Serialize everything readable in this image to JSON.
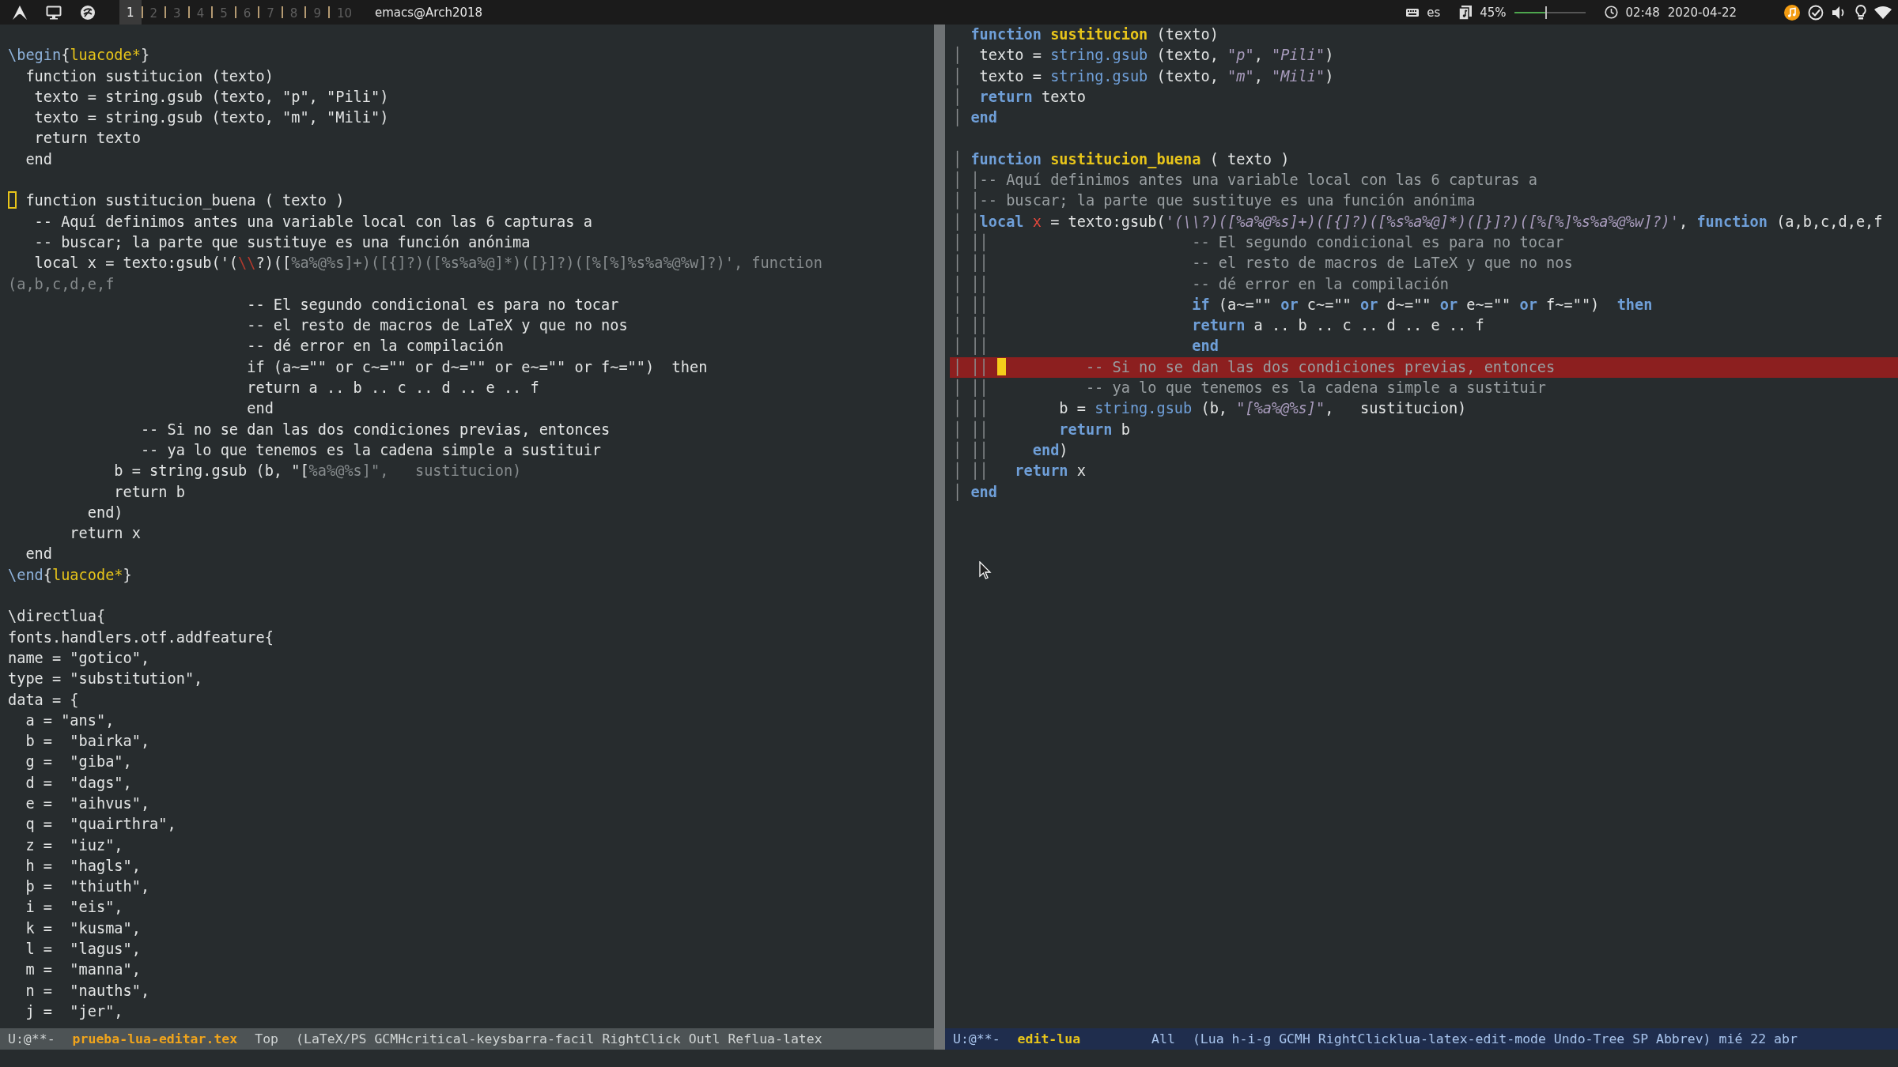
{
  "topbar": {
    "workspaces": [
      {
        "label": "1",
        "selected": true
      },
      {
        "label": "2",
        "selected": false
      },
      {
        "label": "3",
        "selected": false
      },
      {
        "label": "4",
        "selected": false
      },
      {
        "label": "5",
        "selected": false
      },
      {
        "label": "6",
        "selected": false
      },
      {
        "label": "7",
        "selected": false
      },
      {
        "label": "8",
        "selected": false
      },
      {
        "label": "9",
        "selected": false
      },
      {
        "label": "10",
        "selected": false
      }
    ],
    "window_title": "emacs@Arch2018",
    "keyboard_layout": "es",
    "volume": {
      "reading": "45%",
      "level": 0.45
    },
    "time": "02:48",
    "date": "2020-04-22"
  },
  "left_pane": {
    "active": false,
    "lines": [
      {
        "blank_before": true,
        "segments": [
          {
            "kind": "macro",
            "text": "\\begin"
          },
          {
            "kind": "plain",
            "text": "{"
          },
          {
            "kind": "env",
            "text": "luacode*"
          },
          {
            "kind": "plain",
            "text": "}"
          }
        ]
      },
      {
        "segments": [
          {
            "kind": "plain",
            "text": "  function sustitucion (texto)"
          }
        ]
      },
      {
        "segments": [
          {
            "kind": "plain",
            "text": "   texto = string.gsub (texto, \"p\", \"Pili\")"
          }
        ]
      },
      {
        "segments": [
          {
            "kind": "plain",
            "text": "   texto = string.gsub (texto, \"m\", \"Mili\")"
          }
        ]
      },
      {
        "segments": [
          {
            "kind": "plain",
            "text": "   return texto"
          }
        ]
      },
      {
        "segments": [
          {
            "kind": "plain",
            "text": "  end"
          }
        ]
      },
      {
        "blank_before": true,
        "segments": [
          {
            "kind": "plain",
            "text": " function sustitucion_buena ( texto )",
            "cursor_before": true
          }
        ]
      },
      {
        "segments": [
          {
            "kind": "plain",
            "text": "   -- Aquí definimos antes una variable local con las 6 capturas a"
          }
        ]
      },
      {
        "segments": [
          {
            "kind": "plain",
            "text": "   -- buscar; la parte que sustituye es una función anónima"
          }
        ]
      },
      {
        "segments": [
          {
            "kind": "plain",
            "text": "   local x = texto:gsub('("
          },
          {
            "kind": "escape",
            "text": "\\\\"
          },
          {
            "kind": "plain",
            "text": "?)(["
          },
          {
            "kind": "dim",
            "text": "%a%@%s]+)([{]?)([%s%a%@]*)([}]?)([%[%]%s%a%@%w]?)', function"
          }
        ]
      },
      {
        "segments": [
          {
            "kind": "dim",
            "text": "(a,b,c,d,e,f"
          }
        ]
      },
      {
        "segments": [
          {
            "kind": "plain",
            "text": "                           -- El segundo condicional es para no tocar"
          }
        ]
      },
      {
        "segments": [
          {
            "kind": "plain",
            "text": "                           -- el resto de macros de LaTeX y que no nos"
          }
        ]
      },
      {
        "segments": [
          {
            "kind": "plain",
            "text": "                           -- dé error en la compilación"
          }
        ]
      },
      {
        "segments": [
          {
            "kind": "plain",
            "text": "                           if (a~=\"\" or c~=\"\" or d~=\"\" or e~=\"\" or f~=\"\")  then"
          }
        ]
      },
      {
        "segments": [
          {
            "kind": "plain",
            "text": "                           return a .. b .. c .. d .. e .. f"
          }
        ]
      },
      {
        "segments": [
          {
            "kind": "plain",
            "text": "                           end"
          }
        ]
      },
      {
        "segments": [
          {
            "kind": "plain",
            "text": "               -- Si no se dan las dos condiciones previas, entonces"
          }
        ]
      },
      {
        "segments": [
          {
            "kind": "plain",
            "text": "               -- ya lo que tenemos es la cadena simple a sustituir"
          }
        ]
      },
      {
        "segments": [
          {
            "kind": "plain",
            "text": "            b = string.gsub (b, \"["
          },
          {
            "kind": "dim",
            "text": "%a%@%s]\",   sustitucion)"
          }
        ]
      },
      {
        "segments": [
          {
            "kind": "plain",
            "text": "            return b"
          }
        ]
      },
      {
        "segments": [
          {
            "kind": "plain",
            "text": "         end)"
          }
        ]
      },
      {
        "segments": [
          {
            "kind": "plain",
            "text": "       return x"
          }
        ]
      },
      {
        "segments": [
          {
            "kind": "plain",
            "text": "  end"
          }
        ]
      },
      {
        "segments": [
          {
            "kind": "macro",
            "text": "\\end"
          },
          {
            "kind": "plain",
            "text": "{"
          },
          {
            "kind": "env",
            "text": "luacode*"
          },
          {
            "kind": "plain",
            "text": "}"
          }
        ]
      },
      {
        "blank_before": true,
        "segments": [
          {
            "kind": "plain",
            "text": "\\directlua{"
          }
        ]
      },
      {
        "segments": [
          {
            "kind": "plain",
            "text": "fonts.handlers.otf.addfeature{"
          }
        ]
      },
      {
        "segments": [
          {
            "kind": "plain",
            "text": "name = \"gotico\","
          }
        ]
      },
      {
        "segments": [
          {
            "kind": "plain",
            "text": "type = \"substitution\","
          }
        ]
      },
      {
        "segments": [
          {
            "kind": "plain",
            "text": "data = {"
          }
        ]
      },
      {
        "segments": [
          {
            "kind": "plain",
            "text": "  a = \"ans\","
          }
        ]
      },
      {
        "segments": [
          {
            "kind": "plain",
            "text": "  b =  \"bairka\","
          }
        ]
      },
      {
        "segments": [
          {
            "kind": "plain",
            "text": "  g =  \"giba\","
          }
        ]
      },
      {
        "segments": [
          {
            "kind": "plain",
            "text": "  d =  \"dags\","
          }
        ]
      },
      {
        "segments": [
          {
            "kind": "plain",
            "text": "  e =  \"aihvus\","
          }
        ]
      },
      {
        "segments": [
          {
            "kind": "plain",
            "text": "  q =  \"quairthra\","
          }
        ]
      },
      {
        "segments": [
          {
            "kind": "plain",
            "text": "  z =  \"iuz\","
          }
        ]
      },
      {
        "segments": [
          {
            "kind": "plain",
            "text": "  h =  \"hagls\","
          }
        ]
      },
      {
        "segments": [
          {
            "kind": "plain",
            "text": "  þ =  \"thiuth\","
          }
        ]
      },
      {
        "segments": [
          {
            "kind": "plain",
            "text": "  i =  \"eis\","
          }
        ]
      },
      {
        "segments": [
          {
            "kind": "plain",
            "text": "  k =  \"kusma\","
          }
        ]
      },
      {
        "segments": [
          {
            "kind": "plain",
            "text": "  l =  \"lagus\","
          }
        ]
      },
      {
        "segments": [
          {
            "kind": "plain",
            "text": "  m =  \"manna\","
          }
        ]
      },
      {
        "segments": [
          {
            "kind": "plain",
            "text": "  n =  \"nauths\","
          }
        ]
      },
      {
        "segments": [
          {
            "kind": "plain",
            "text": "  j =  \"jer\","
          }
        ]
      }
    ],
    "mode_line": {
      "status": "U:@**-",
      "buffer": "prueba-lua-editar.tex",
      "position": "Top",
      "modes": "(LaTeX/PS GCMHcritical-keysbarra-facil RightClick Outl Reflua-latex"
    }
  },
  "right_pane": {
    "active": true,
    "lines": [
      {
        "segments": [
          {
            "kind": "keyword",
            "text": "  function"
          },
          {
            "kind": "name",
            "text": " sustitucion"
          },
          {
            "kind": "plain",
            "text": " (texto)"
          }
        ]
      },
      {
        "segments": [
          {
            "kind": "guide",
            "text": "│"
          },
          {
            "kind": "plain",
            "text": "  texto = "
          },
          {
            "kind": "builtin",
            "text": "string.gsub"
          },
          {
            "kind": "plain",
            "text": " (texto, "
          },
          {
            "kind": "string",
            "text": "\"p\""
          },
          {
            "kind": "plain",
            "text": ", "
          },
          {
            "kind": "string",
            "text": "\"Pili\""
          },
          {
            "kind": "plain",
            "text": ")"
          }
        ]
      },
      {
        "segments": [
          {
            "kind": "guide",
            "text": "│"
          },
          {
            "kind": "plain",
            "text": "  texto = "
          },
          {
            "kind": "builtin",
            "text": "string.gsub"
          },
          {
            "kind": "plain",
            "text": " (texto, "
          },
          {
            "kind": "string",
            "text": "\"m\""
          },
          {
            "kind": "plain",
            "text": ", "
          },
          {
            "kind": "string",
            "text": "\"Mili\""
          },
          {
            "kind": "plain",
            "text": ")"
          }
        ]
      },
      {
        "segments": [
          {
            "kind": "guide",
            "text": "│"
          },
          {
            "kind": "keyword",
            "text": "  return"
          },
          {
            "kind": "plain",
            "text": " texto"
          }
        ]
      },
      {
        "segments": [
          {
            "kind": "guide",
            "text": "│"
          },
          {
            "kind": "keyword",
            "text": " end"
          }
        ]
      },
      {
        "blank_before": true,
        "segments": [
          {
            "kind": "guide",
            "text": "│"
          },
          {
            "kind": "keyword",
            "text": " function"
          },
          {
            "kind": "name",
            "text": " sustitucion_buena"
          },
          {
            "kind": "plain",
            "text": " ( texto )"
          }
        ]
      },
      {
        "segments": [
          {
            "kind": "guide",
            "text": "│ │"
          },
          {
            "kind": "comment",
            "text": "-- Aquí definimos antes una variable local con las 6 capturas a"
          }
        ]
      },
      {
        "segments": [
          {
            "kind": "guide",
            "text": "│ │"
          },
          {
            "kind": "comment",
            "text": "-- buscar; la parte que sustituye es una función anónima"
          }
        ]
      },
      {
        "segments": [
          {
            "kind": "guide",
            "text": "│ │"
          },
          {
            "kind": "keyword",
            "text": "local"
          },
          {
            "kind": "variable",
            "text": " x"
          },
          {
            "kind": "plain",
            "text": " = texto:gsub("
          },
          {
            "kind": "string",
            "text": "'(\\\\?)([%a%@%s]+)([{]?)([%s%a%@]*)([}]?)([%[%]%s%a%@%w]?)'"
          },
          {
            "kind": "plain",
            "text": ", "
          },
          {
            "kind": "keyword",
            "text": "function"
          },
          {
            "kind": "plain",
            "text": " (a,b,c,d,e,f"
          }
        ]
      },
      {
        "segments": [
          {
            "kind": "guide",
            "text": "│ ││"
          },
          {
            "kind": "comment",
            "text": "                       -- El segundo condicional es para no tocar"
          }
        ]
      },
      {
        "segments": [
          {
            "kind": "guide",
            "text": "│ ││"
          },
          {
            "kind": "comment",
            "text": "                       -- el resto de macros de LaTeX y que no nos"
          }
        ]
      },
      {
        "segments": [
          {
            "kind": "guide",
            "text": "│ ││"
          },
          {
            "kind": "comment",
            "text": "                       -- dé error en la compilación"
          }
        ]
      },
      {
        "segments": [
          {
            "kind": "guide",
            "text": "│ ││"
          },
          {
            "kind": "keyword",
            "text": "                       if"
          },
          {
            "kind": "plain",
            "text": " (a~=\"\" "
          },
          {
            "kind": "keyword",
            "text": "or"
          },
          {
            "kind": "plain",
            "text": " c~=\"\" "
          },
          {
            "kind": "keyword",
            "text": "or"
          },
          {
            "kind": "plain",
            "text": " d~=\"\" "
          },
          {
            "kind": "keyword",
            "text": "or"
          },
          {
            "kind": "plain",
            "text": " e~=\"\" "
          },
          {
            "kind": "keyword",
            "text": "or"
          },
          {
            "kind": "plain",
            "text": " f~=\"\")  "
          },
          {
            "kind": "keyword",
            "text": "then"
          }
        ]
      },
      {
        "segments": [
          {
            "kind": "guide",
            "text": "│ ││"
          },
          {
            "kind": "keyword",
            "text": "                       return"
          },
          {
            "kind": "plain",
            "text": " a .. b .. c .. d .. e .. f"
          }
        ]
      },
      {
        "segments": [
          {
            "kind": "guide",
            "text": "│ ││"
          },
          {
            "kind": "keyword",
            "text": "                       end"
          }
        ]
      },
      {
        "highlighted": true,
        "segments": [
          {
            "kind": "guide",
            "text": "│ ││ "
          },
          {
            "kind": "comment",
            "text": "         -- Si no se dan las dos condiciones previas, entonces",
            "cursor_before": true
          }
        ]
      },
      {
        "segments": [
          {
            "kind": "guide",
            "text": "│ ││"
          },
          {
            "kind": "comment",
            "text": "           -- ya lo que tenemos es la cadena simple a sustituir"
          }
        ]
      },
      {
        "segments": [
          {
            "kind": "guide",
            "text": "│ ││"
          },
          {
            "kind": "plain",
            "text": "        b = "
          },
          {
            "kind": "builtin",
            "text": "string.gsub"
          },
          {
            "kind": "plain",
            "text": " (b, "
          },
          {
            "kind": "string",
            "text": "\"[%a%@%s]\""
          },
          {
            "kind": "plain",
            "text": ",   sustitucion)"
          }
        ]
      },
      {
        "segments": [
          {
            "kind": "guide",
            "text": "│ ││"
          },
          {
            "kind": "keyword",
            "text": "        return"
          },
          {
            "kind": "plain",
            "text": " b"
          }
        ]
      },
      {
        "segments": [
          {
            "kind": "guide",
            "text": "│ ││"
          },
          {
            "kind": "keyword",
            "text": "     end"
          },
          {
            "kind": "plain",
            "text": ")"
          }
        ]
      },
      {
        "segments": [
          {
            "kind": "guide",
            "text": "│ ││"
          },
          {
            "kind": "keyword",
            "text": "   return"
          },
          {
            "kind": "plain",
            "text": " x"
          }
        ]
      },
      {
        "segments": [
          {
            "kind": "guide",
            "text": "│"
          },
          {
            "kind": "keyword",
            "text": " end"
          }
        ]
      }
    ],
    "mode_line": {
      "status": "U:@**-",
      "buffer": "edit-lua",
      "position": "All",
      "modes": "(Lua h-i-g GCMH RightClicklua-latex-edit-mode Undo-Tree SP Abbrev)",
      "clock": "mié 22 abr"
    }
  }
}
